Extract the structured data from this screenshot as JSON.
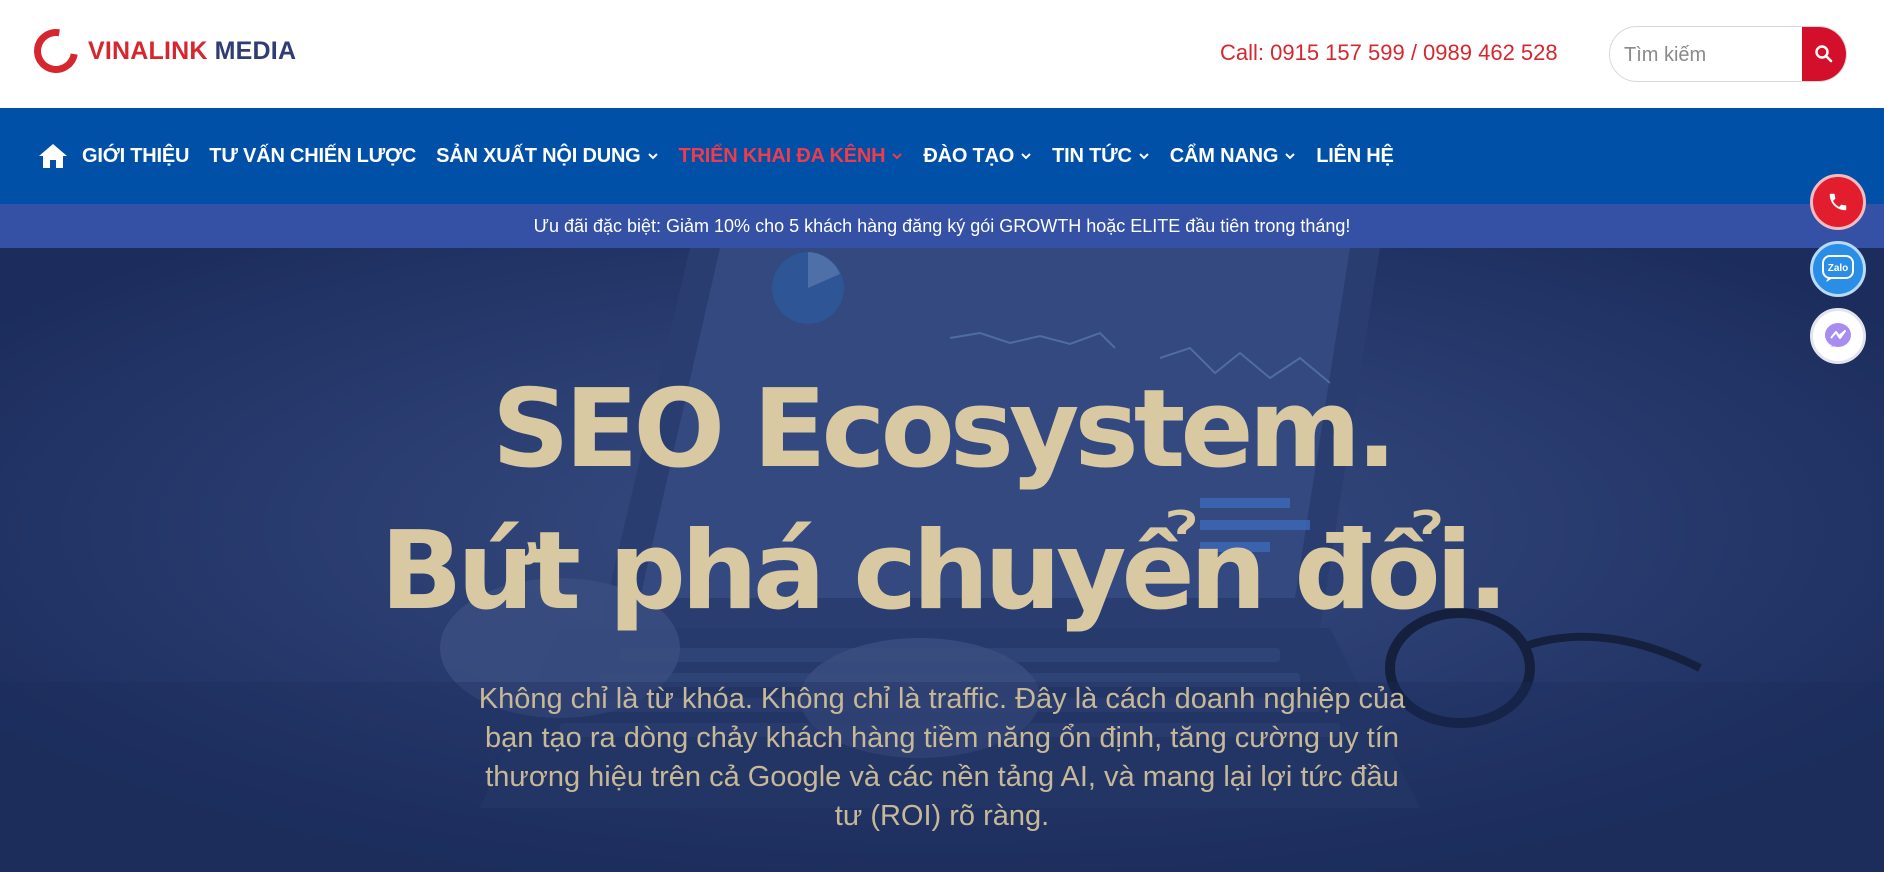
{
  "header": {
    "logo_part1": "VINALINK",
    "logo_part2": "MEDIA",
    "call_text": "Call: 0915 157 599 / 0989 462 528",
    "search_placeholder": "Tìm kiếm"
  },
  "nav": {
    "items": [
      {
        "label": "GIỚI THIỆU",
        "dropdown": false,
        "active": false
      },
      {
        "label": "TƯ VẤN CHIẾN LƯỢC",
        "dropdown": false,
        "active": false
      },
      {
        "label": "SẢN XUẤT NỘI DUNG",
        "dropdown": true,
        "active": false
      },
      {
        "label": "TRIỂN KHAI ĐA KÊNH",
        "dropdown": true,
        "active": true
      },
      {
        "label": "ĐÀO TẠO",
        "dropdown": true,
        "active": false
      },
      {
        "label": "TIN TỨC",
        "dropdown": true,
        "active": false
      },
      {
        "label": "CẨM NANG",
        "dropdown": true,
        "active": false
      },
      {
        "label": "LIÊN HỆ",
        "dropdown": false,
        "active": false
      }
    ]
  },
  "promo": {
    "text": "Ưu đãi đặc biệt: Giảm 10% cho 5 khách hàng đăng ký gói GROWTH hoặc ELITE đầu tiên trong tháng!"
  },
  "hero": {
    "title_line1": "SEO Ecosystem.",
    "title_line2": "Bứt phá chuyển đổi.",
    "subtitle": "Không chỉ là từ khóa. Không chỉ là traffic. Đây là cách doanh nghiệp của bạn tạo ra dòng chảy khách hàng tiềm năng ổn định, tăng cường uy tín thương hiệu trên cả Google và các nền tảng AI, và mang lại lợi tức đầu tư (ROI) rõ ràng."
  },
  "floating": {
    "zalo_label": "Zalo"
  },
  "colors": {
    "brand_red": "#d6262e",
    "nav_blue": "#0050a8",
    "promo_blue": "#3551a5",
    "hero_navy": "#1c2d5d",
    "hero_text": "#d9c9a2"
  },
  "icons": [
    "home-icon",
    "search-icon",
    "chevron-down-icon",
    "phone-icon",
    "zalo-icon",
    "messenger-icon"
  ]
}
